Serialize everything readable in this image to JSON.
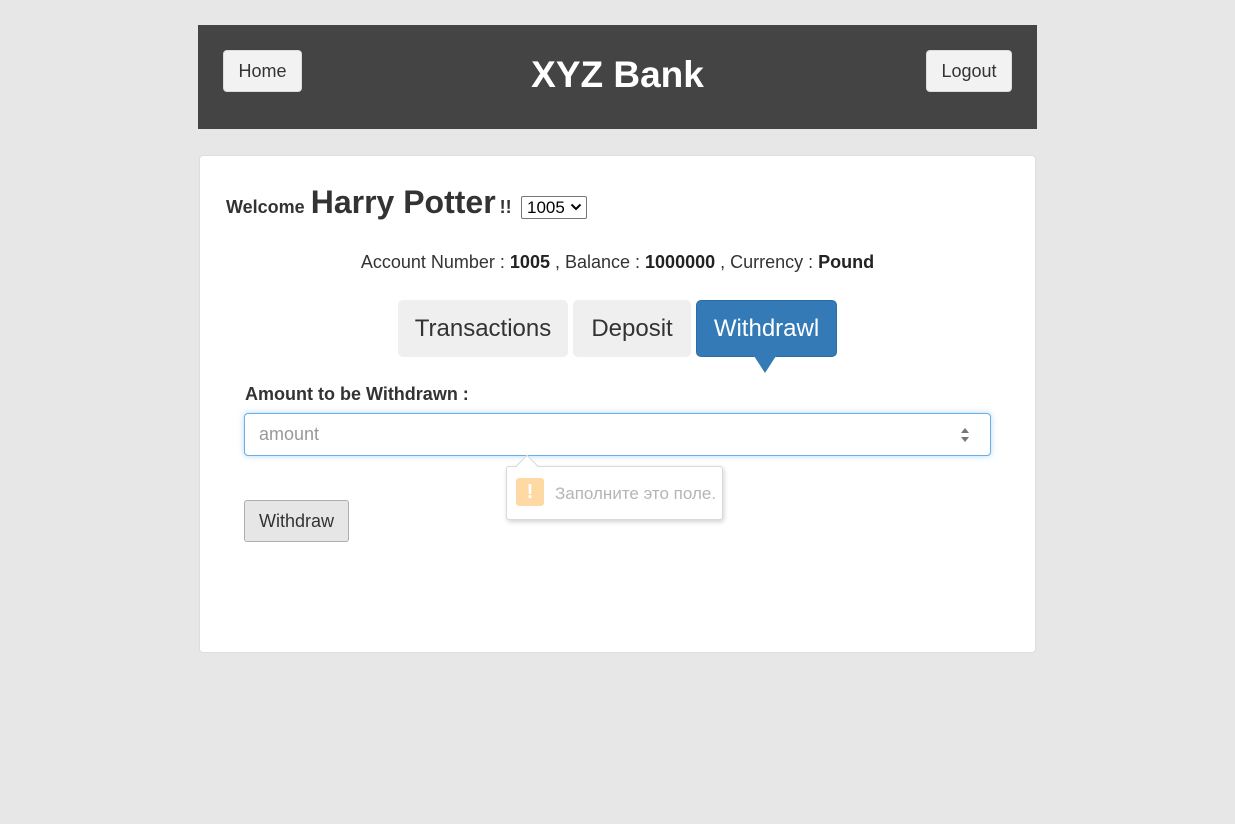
{
  "header": {
    "title": "XYZ Bank",
    "home_label": "Home",
    "logout_label": "Logout"
  },
  "customer": {
    "welcome": "Welcome",
    "name": "Harry Potter",
    "exclaim": "!!",
    "selected_account": "1005"
  },
  "account_info": {
    "account_number_label": "Account Number : ",
    "account_number": "1005",
    "balance_label": " , Balance : ",
    "balance": "1000000",
    "currency_label": " , Currency : ",
    "currency": "Pound"
  },
  "tabs": [
    {
      "label": "Transactions",
      "active": false
    },
    {
      "label": "Deposit",
      "active": false
    },
    {
      "label": "Withdrawl",
      "active": true
    }
  ],
  "withdraw_form": {
    "label": "Amount to be Withdrawn :",
    "placeholder": "amount",
    "value": "",
    "submit_label": "Withdraw"
  },
  "validation_tooltip": {
    "icon": "exclamation-icon",
    "icon_glyph": "!",
    "message": "Заполните это поле."
  },
  "colors": {
    "header_bg": "#444444",
    "page_bg": "#e7e7e7",
    "active_tab": "#337ab7",
    "warn_icon_bg": "#ffd9a4"
  }
}
